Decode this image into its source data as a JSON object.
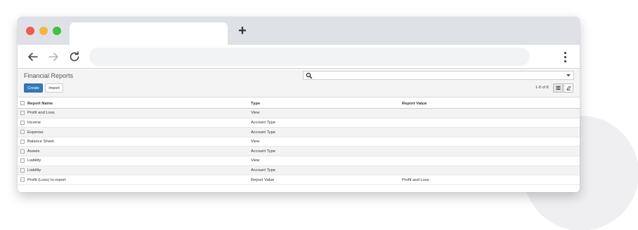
{
  "browser": {
    "new_tab_glyph": "+",
    "back_icon": "arrow-left",
    "forward_icon": "arrow-right",
    "reload_icon": "reload",
    "menu_icon": "kebab-vertical"
  },
  "app": {
    "title": "Financial Reports",
    "search": {
      "value": ""
    },
    "buttons": {
      "create": "Create",
      "import": "Import"
    },
    "pager": "1-8 of 8",
    "accent_color": "#337ab7"
  },
  "table": {
    "headers": [
      "Report Name",
      "Type",
      "Report Value"
    ],
    "rows": [
      [
        "Profit and Loss",
        "View",
        ""
      ],
      [
        "Income",
        "Account Type",
        ""
      ],
      [
        "Expense",
        "Account Type",
        ""
      ],
      [
        "Balance Sheet",
        "View",
        ""
      ],
      [
        "Assets",
        "Account Type",
        ""
      ],
      [
        "Liability",
        "View",
        ""
      ],
      [
        "Liability",
        "Account Type",
        ""
      ],
      [
        "Profit (Loss) to report",
        "Report Value",
        "Profit and Loss"
      ]
    ]
  }
}
